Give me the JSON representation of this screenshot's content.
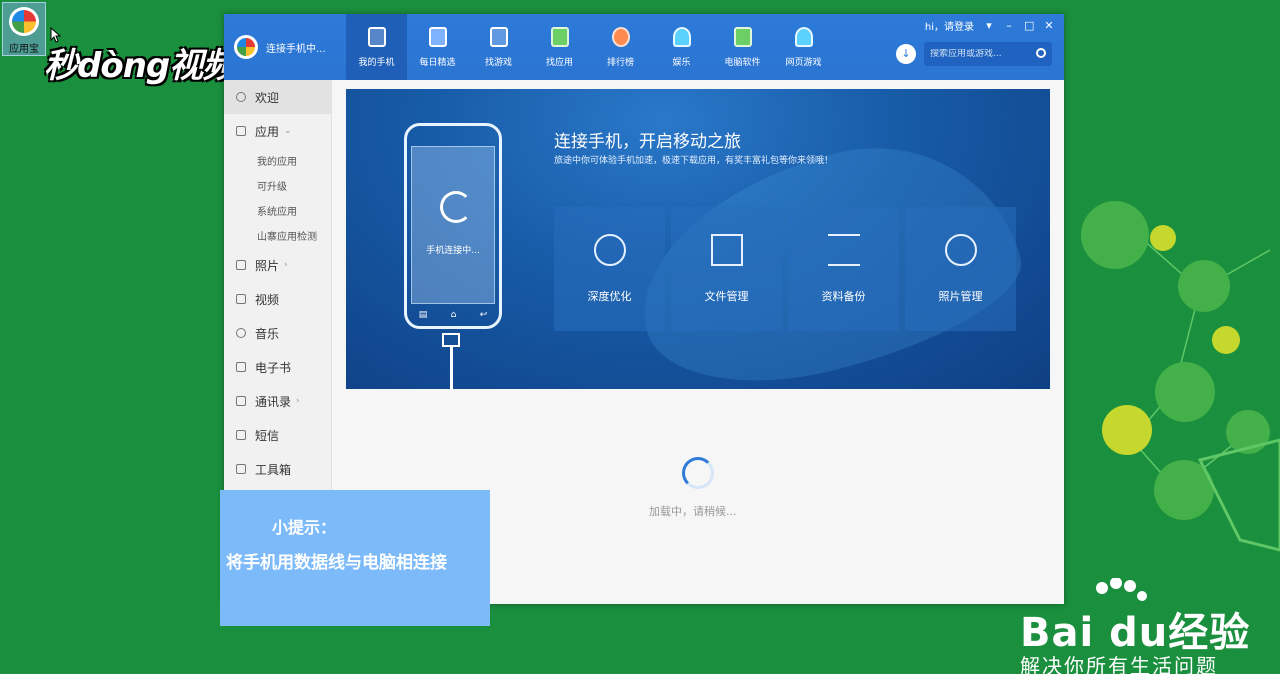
{
  "desktop": {
    "shortcut_label": "应用宝",
    "watermark": "秒dòng视频"
  },
  "baidu": {
    "brand": "Bai du经验",
    "slogan": "解决你所有生活问题"
  },
  "app": {
    "phone_status": "连接手机中...",
    "login_text": "hi，请登录",
    "search_placeholder": "搜索应用或游戏...",
    "nav_tabs": [
      {
        "label": "我的手机",
        "icon": "phone-icon",
        "active": true
      },
      {
        "label": "每日精选",
        "icon": "calendar-star-icon",
        "active": false
      },
      {
        "label": "找游戏",
        "icon": "gamepad-icon",
        "active": false
      },
      {
        "label": "找应用",
        "icon": "shopping-bag-icon",
        "active": false
      },
      {
        "label": "排行榜",
        "icon": "medal-icon",
        "active": false
      },
      {
        "label": "娱乐",
        "icon": "tv-icon",
        "active": false
      },
      {
        "label": "电脑软件",
        "icon": "monitor-icon",
        "active": false
      },
      {
        "label": "网页游戏",
        "icon": "web-game-icon",
        "active": false
      }
    ],
    "sidebar": {
      "welcome": "欢迎",
      "apps": "应用",
      "app_subs": [
        "我的应用",
        "可升级",
        "系统应用",
        "山寨应用检测"
      ],
      "photos": "照片",
      "video": "视频",
      "music": "音乐",
      "ebook": "电子书",
      "contacts": "通讯录",
      "sms": "短信",
      "toolbox": "工具箱"
    },
    "banner": {
      "title": "连接手机，开启移动之旅",
      "subtitle": "旅途中你可体验手机加速，极速下载应用，有奖丰富礼包等你来领哦！",
      "phone_screen_text": "手机连接中...",
      "features": [
        "深度优化",
        "文件管理",
        "资料备份",
        "照片管理"
      ]
    },
    "loading_text": "加载中，请稍候..."
  },
  "hint": {
    "title": "小提示：",
    "body": "将手机用数据线与电脑相连接"
  }
}
